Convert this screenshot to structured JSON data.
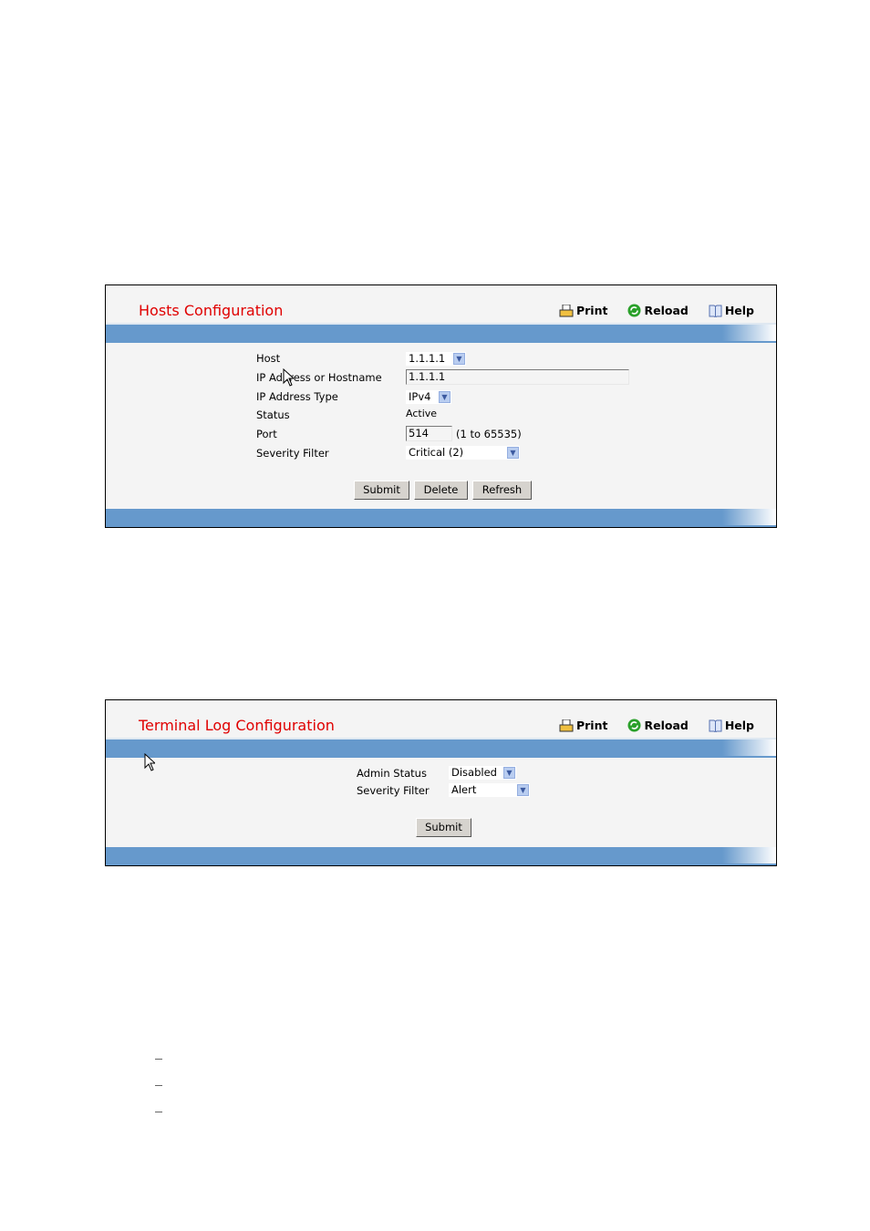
{
  "hosts": {
    "title": "Hosts Configuration",
    "toolbar": {
      "print": "Print",
      "reload": "Reload",
      "help": "Help"
    },
    "fields": {
      "host_label": "Host",
      "host_value": "1.1.1.1",
      "ip_label": "IP Address or Hostname",
      "ip_value": "1.1.1.1",
      "type_label": "IP Address Type",
      "type_value": "IPv4",
      "status_label": "Status",
      "status_value": "Active",
      "port_label": "Port",
      "port_value": "514",
      "port_hint": "(1 to 65535)",
      "severity_label": "Severity Filter",
      "severity_value": "Critical (2)"
    },
    "buttons": {
      "submit": "Submit",
      "delete": "Delete",
      "refresh": "Refresh"
    }
  },
  "terminal": {
    "title": "Terminal Log Configuration",
    "toolbar": {
      "print": "Print",
      "reload": "Reload",
      "help": "Help"
    },
    "fields": {
      "admin_label": "Admin Status",
      "admin_value": "Disabled",
      "severity_label": "Severity Filter",
      "severity_value": "Alert"
    },
    "buttons": {
      "submit": "Submit"
    }
  },
  "colors": {
    "title": "#e00000",
    "band": "#6699cc",
    "panel_bg": "#f4f4f4"
  }
}
